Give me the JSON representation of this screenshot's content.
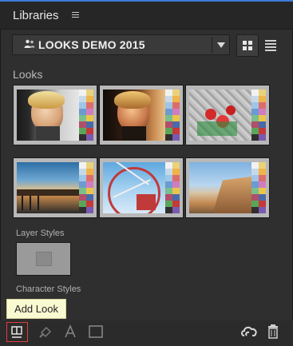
{
  "panel": {
    "title": "Libraries"
  },
  "library": {
    "name": "LOOKS DEMO 2015"
  },
  "sections": {
    "looks": "Looks",
    "layer_styles": "Layer Styles",
    "character_styles": "Character Styles"
  },
  "tooltip": {
    "text": "Add Look"
  },
  "looks": [
    {
      "name": "look-portrait-1"
    },
    {
      "name": "look-portrait-2"
    },
    {
      "name": "look-flowers"
    },
    {
      "name": "look-pier"
    },
    {
      "name": "look-ferris-wheel"
    },
    {
      "name": "look-coast"
    }
  ],
  "swatch_colors": [
    "#f2f2f2",
    "#e9d27a",
    "#c7d9e8",
    "#f0b44a",
    "#9fc6e6",
    "#dd6d6d",
    "#6d9ad0",
    "#d07dbf",
    "#7abf8c",
    "#eac54a",
    "#b14e6a",
    "#4a6aa8",
    "#5aa55a",
    "#c43a3a",
    "#2f2f2f",
    "#7a5ab0"
  ],
  "colors": {
    "accent": "#3e7bd9",
    "highlight": "#e53b3b"
  },
  "icons": {
    "panel_menu": "hamburger-icon",
    "library": "people-icon",
    "dropdown": "triangle-down-icon",
    "grid_view": "grid-icon",
    "list_view": "list-icon",
    "add_look": "add-look-icon",
    "add_fill": "fill-icon",
    "add_text": "text-icon",
    "add_graphic": "graphic-icon",
    "cc_sync": "creative-cloud-icon",
    "delete": "trash-icon"
  }
}
